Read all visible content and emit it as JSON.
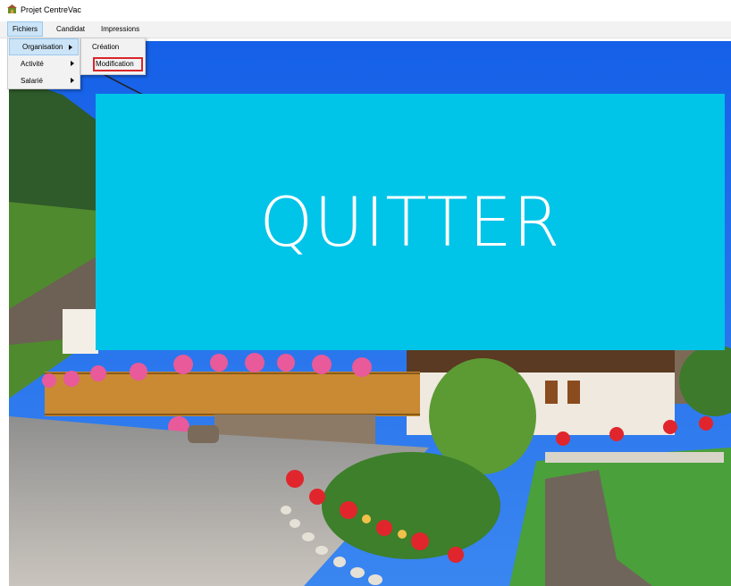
{
  "window": {
    "title": "Projet CentreVac"
  },
  "menubar": {
    "items": [
      {
        "label": "Fichiers"
      },
      {
        "label": "Candidat"
      },
      {
        "label": "Impressions"
      }
    ]
  },
  "fichiers_menu": {
    "items": [
      {
        "label": "Organisation"
      },
      {
        "label": "Activité"
      },
      {
        "label": "Salarié"
      }
    ]
  },
  "organisation_menu": {
    "items": [
      {
        "label": "Création"
      },
      {
        "label": "Modification"
      }
    ]
  },
  "tile": {
    "label": "QUITTER",
    "color": "#00c4e8"
  },
  "colors": {
    "menu_highlight": "#cce4f7",
    "annotation": "#d9262c"
  }
}
